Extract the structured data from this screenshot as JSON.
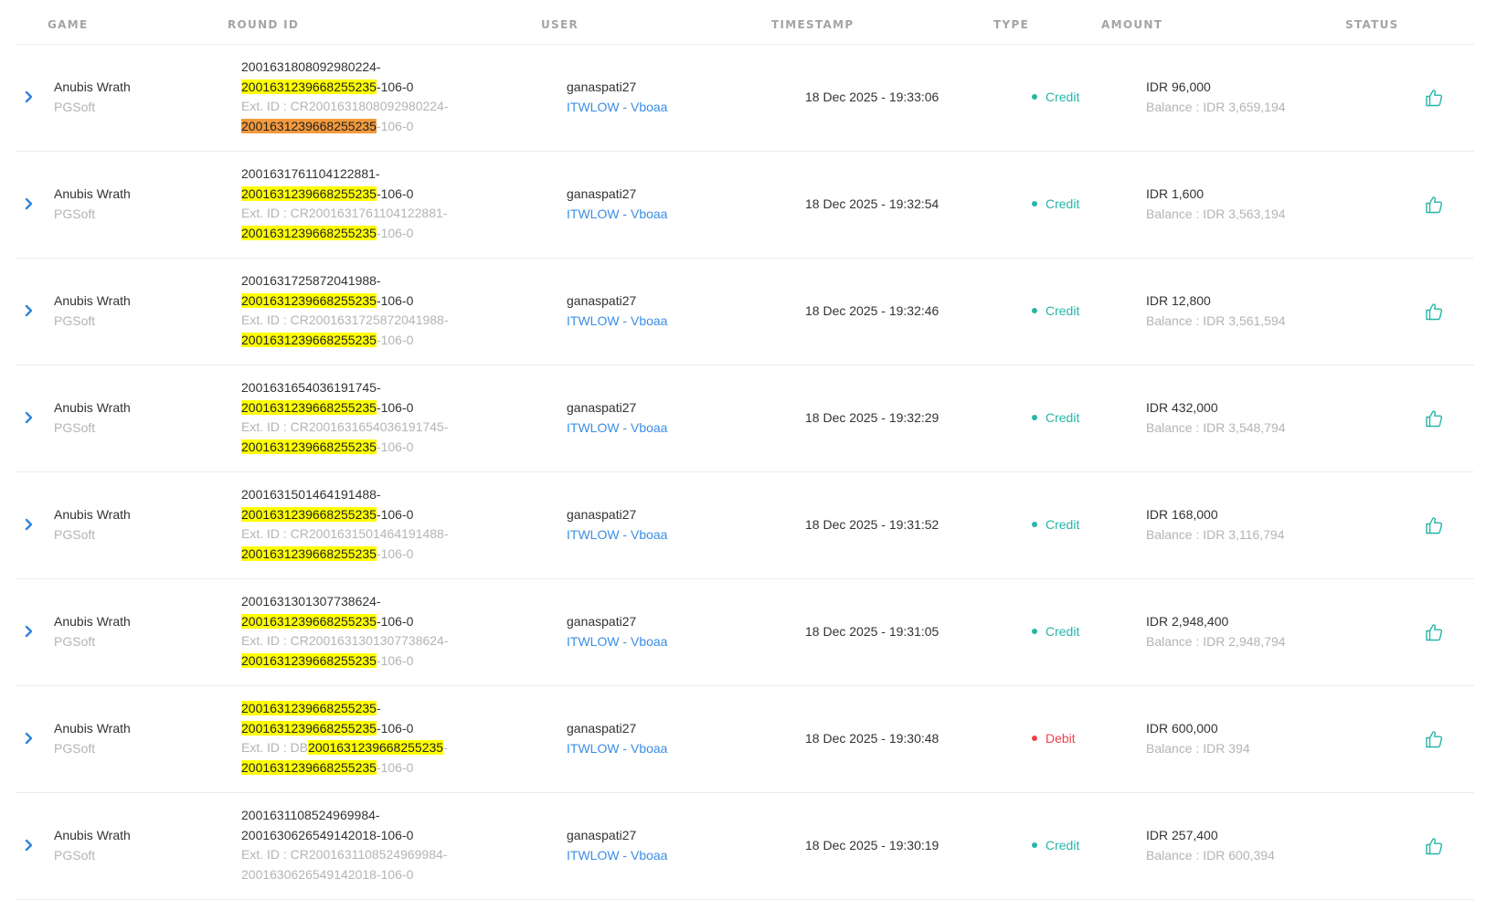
{
  "columns": {
    "game": "GAME",
    "round_id": "ROUND ID",
    "user": "USER",
    "timestamp": "TIMESTAMP",
    "type": "TYPE",
    "amount": "AMOUNT",
    "status": "STATUS"
  },
  "colors": {
    "credit": "#26b5a8",
    "debit": "#f0414b",
    "link": "#3a8ee6",
    "highlight": "#ffff00",
    "highlight_current": "#f39a3c"
  },
  "icons": {
    "expand": "chevron-right-icon",
    "status": "thumbs-up-icon"
  },
  "rows": [
    {
      "game": "Anubis Wrath",
      "provider": "PGSoft",
      "round": [
        [
          {
            "t": "2001631808092980224-",
            "h": ""
          }
        ],
        [
          {
            "t": "2001631239668255235",
            "h": "y"
          },
          {
            "t": "-106-0",
            "h": ""
          }
        ]
      ],
      "ext": [
        [
          {
            "t": "Ext. ID : CR2001631808092980224-",
            "h": ""
          }
        ],
        [
          {
            "t": "2001631239668255235",
            "h": "o"
          },
          {
            "t": "-106-0",
            "h": ""
          }
        ]
      ],
      "user": "ganaspati27",
      "agent": "ITWLOW - Vboaa",
      "timestamp": "18 Dec 2025 - 19:33:06",
      "type": "Credit",
      "amount": "IDR 96,000",
      "balance": "Balance : IDR 3,659,194"
    },
    {
      "game": "Anubis Wrath",
      "provider": "PGSoft",
      "round": [
        [
          {
            "t": "2001631761104122881-",
            "h": ""
          }
        ],
        [
          {
            "t": "2001631239668255235",
            "h": "y"
          },
          {
            "t": "-106-0",
            "h": ""
          }
        ]
      ],
      "ext": [
        [
          {
            "t": "Ext. ID : CR2001631761104122881-",
            "h": ""
          }
        ],
        [
          {
            "t": "2001631239668255235",
            "h": "y"
          },
          {
            "t": "-106-0",
            "h": ""
          }
        ]
      ],
      "user": "ganaspati27",
      "agent": "ITWLOW - Vboaa",
      "timestamp": "18 Dec 2025 - 19:32:54",
      "type": "Credit",
      "amount": "IDR 1,600",
      "balance": "Balance : IDR 3,563,194"
    },
    {
      "game": "Anubis Wrath",
      "provider": "PGSoft",
      "round": [
        [
          {
            "t": "2001631725872041988-",
            "h": ""
          }
        ],
        [
          {
            "t": "2001631239668255235",
            "h": "y"
          },
          {
            "t": "-106-0",
            "h": ""
          }
        ]
      ],
      "ext": [
        [
          {
            "t": "Ext. ID : CR2001631725872041988-",
            "h": ""
          }
        ],
        [
          {
            "t": "2001631239668255235",
            "h": "y"
          },
          {
            "t": "-106-0",
            "h": ""
          }
        ]
      ],
      "user": "ganaspati27",
      "agent": "ITWLOW - Vboaa",
      "timestamp": "18 Dec 2025 - 19:32:46",
      "type": "Credit",
      "amount": "IDR 12,800",
      "balance": "Balance : IDR 3,561,594"
    },
    {
      "game": "Anubis Wrath",
      "provider": "PGSoft",
      "round": [
        [
          {
            "t": "2001631654036191745-",
            "h": ""
          }
        ],
        [
          {
            "t": "2001631239668255235",
            "h": "y"
          },
          {
            "t": "-106-0",
            "h": ""
          }
        ]
      ],
      "ext": [
        [
          {
            "t": "Ext. ID : CR2001631654036191745-",
            "h": ""
          }
        ],
        [
          {
            "t": "2001631239668255235",
            "h": "y"
          },
          {
            "t": "-106-0",
            "h": ""
          }
        ]
      ],
      "user": "ganaspati27",
      "agent": "ITWLOW - Vboaa",
      "timestamp": "18 Dec 2025 - 19:32:29",
      "type": "Credit",
      "amount": "IDR 432,000",
      "balance": "Balance : IDR 3,548,794"
    },
    {
      "game": "Anubis Wrath",
      "provider": "PGSoft",
      "round": [
        [
          {
            "t": "2001631501464191488-",
            "h": ""
          }
        ],
        [
          {
            "t": "2001631239668255235",
            "h": "y"
          },
          {
            "t": "-106-0",
            "h": ""
          }
        ]
      ],
      "ext": [
        [
          {
            "t": "Ext. ID : CR2001631501464191488-",
            "h": ""
          }
        ],
        [
          {
            "t": "2001631239668255235",
            "h": "y"
          },
          {
            "t": "-106-0",
            "h": ""
          }
        ]
      ],
      "user": "ganaspati27",
      "agent": "ITWLOW - Vboaa",
      "timestamp": "18 Dec 2025 - 19:31:52",
      "type": "Credit",
      "amount": "IDR 168,000",
      "balance": "Balance : IDR 3,116,794"
    },
    {
      "game": "Anubis Wrath",
      "provider": "PGSoft",
      "round": [
        [
          {
            "t": "2001631301307738624-",
            "h": ""
          }
        ],
        [
          {
            "t": "2001631239668255235",
            "h": "y"
          },
          {
            "t": "-106-0",
            "h": ""
          }
        ]
      ],
      "ext": [
        [
          {
            "t": "Ext. ID : CR2001631301307738624-",
            "h": ""
          }
        ],
        [
          {
            "t": "2001631239668255235",
            "h": "y"
          },
          {
            "t": "-106-0",
            "h": ""
          }
        ]
      ],
      "user": "ganaspati27",
      "agent": "ITWLOW - Vboaa",
      "timestamp": "18 Dec 2025 - 19:31:05",
      "type": "Credit",
      "amount": "IDR 2,948,400",
      "balance": "Balance : IDR 2,948,794"
    },
    {
      "game": "Anubis Wrath",
      "provider": "PGSoft",
      "round": [
        [
          {
            "t": "2001631239668255235",
            "h": "y"
          },
          {
            "t": "-",
            "h": ""
          }
        ],
        [
          {
            "t": "2001631239668255235",
            "h": "y"
          },
          {
            "t": "-106-0",
            "h": ""
          }
        ]
      ],
      "ext": [
        [
          {
            "t": "Ext. ID : DB",
            "h": ""
          },
          {
            "t": "2001631239668255235",
            "h": "y"
          },
          {
            "t": "-",
            "h": ""
          }
        ],
        [
          {
            "t": "2001631239668255235",
            "h": "y"
          },
          {
            "t": "-106-0",
            "h": ""
          }
        ]
      ],
      "user": "ganaspati27",
      "agent": "ITWLOW - Vboaa",
      "timestamp": "18 Dec 2025 - 19:30:48",
      "type": "Debit",
      "amount": "IDR 600,000",
      "balance": "Balance : IDR 394"
    },
    {
      "game": "Anubis Wrath",
      "provider": "PGSoft",
      "round": [
        [
          {
            "t": "2001631108524969984-",
            "h": ""
          }
        ],
        [
          {
            "t": "2001630626549142018-106-0",
            "h": ""
          }
        ]
      ],
      "ext": [
        [
          {
            "t": "Ext. ID : CR2001631108524969984-",
            "h": ""
          }
        ],
        [
          {
            "t": "2001630626549142018-106-0",
            "h": ""
          }
        ]
      ],
      "user": "ganaspati27",
      "agent": "ITWLOW - Vboaa",
      "timestamp": "18 Dec 2025 - 19:30:19",
      "type": "Credit",
      "amount": "IDR 257,400",
      "balance": "Balance : IDR 600,394"
    }
  ]
}
